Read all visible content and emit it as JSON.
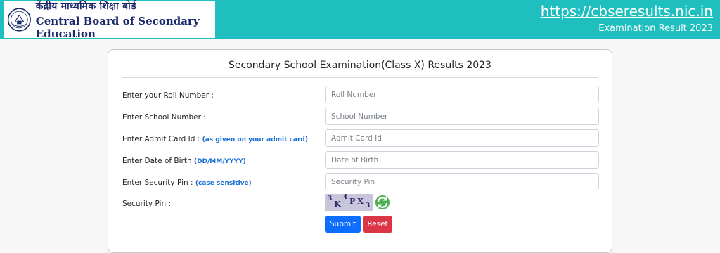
{
  "header": {
    "logo_hindi": "केंद्रीय माध्यमिक शिक्षा बोर्ड",
    "logo_english": "Central Board of Secondary Education",
    "site_url": "https://cbseresults.nic.in",
    "subtitle": "Examination Result 2023",
    "bg_color": "#1fbfbf"
  },
  "form": {
    "title": "Secondary School Examination(Class X) Results 2023",
    "fields": [
      {
        "label": "Enter your Roll Number :",
        "hint": "",
        "placeholder": "Roll Number"
      },
      {
        "label": "Enter School Number :",
        "hint": "",
        "placeholder": "School Number"
      },
      {
        "label": "Enter Admit Card Id :",
        "hint": "(as given on your admit card)",
        "placeholder": "Admit Card Id"
      },
      {
        "label": "Enter Date of Birth",
        "hint": "(DD/MM/YYYY)",
        "placeholder": "Date of Birth"
      },
      {
        "label": "Enter Security Pin :",
        "hint": "(case sensitive)",
        "placeholder": "Security Pin"
      }
    ],
    "security_pin_label": "Security Pin :",
    "captcha_chars": [
      "3",
      "K",
      "4",
      "P",
      "X",
      "3"
    ],
    "refresh_icon": "refresh-icon",
    "submit_label": "Submit",
    "reset_label": "Reset",
    "submit_color": "#0d6efd",
    "reset_color": "#dc3545"
  }
}
